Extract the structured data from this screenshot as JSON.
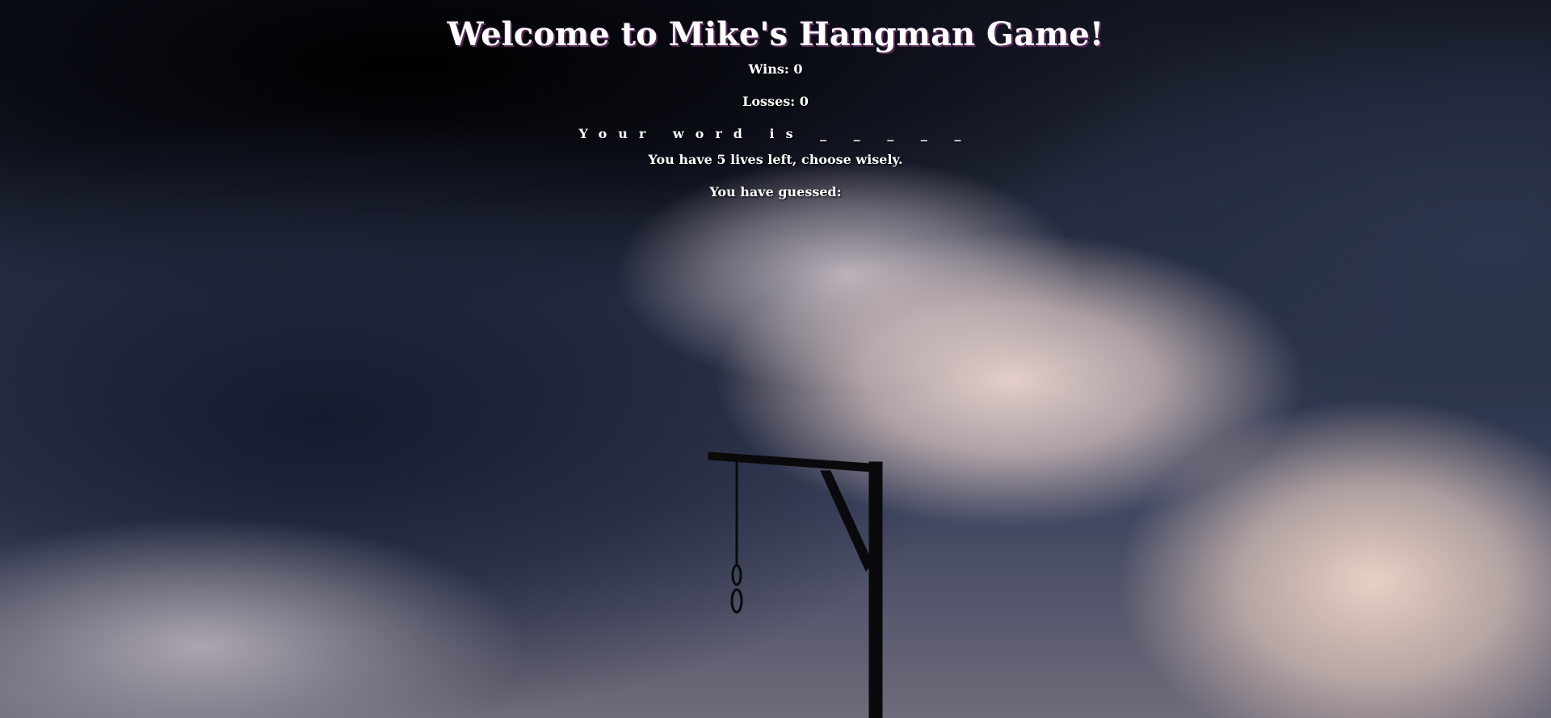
{
  "game": {
    "title": "Welcome to Mike's Hangman Game!",
    "wins_label": "Wins: 0",
    "losses_label": "Losses: 0",
    "word_prefix": "Your word is",
    "word_display": "_ _ _ _ _",
    "lives_label": "You have 5 lives left, choose wisely.",
    "guessed_label": "You have guessed:"
  },
  "colors": {
    "text": "#ffffff",
    "title_shadow": "#5a2a5a",
    "gallows": "#0a0a0c"
  }
}
